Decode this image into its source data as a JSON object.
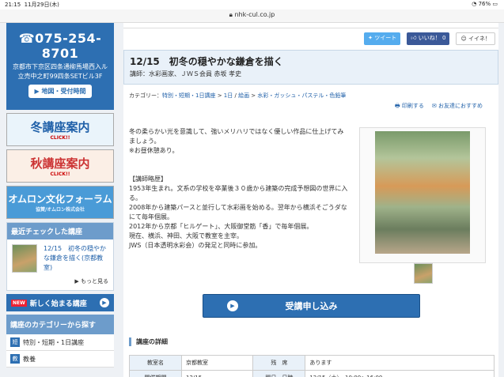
{
  "status": {
    "time": "21:15",
    "date": "11月29日(木)",
    "battery": "76%"
  },
  "browser": {
    "url": "nhk-cul.co.jp"
  },
  "sidebar": {
    "phone": "075-254-8701",
    "address1": "京都市下京区四条通柳馬場西入ル",
    "address2": "立売中之町99四条SETビル3F",
    "map_button": "地図・受付時間",
    "winter_banner": {
      "big": "冬講座案内",
      "small": "CLICK!!"
    },
    "autumn_banner": {
      "big": "秋講座案内",
      "small": "CLICK!!"
    },
    "omron_banner": {
      "big": "オムロン文化フォーラム",
      "small": "協賛/オムロン株式会社"
    },
    "recent_title": "最近チェックした講座",
    "recent_item": "12/15　初冬の穏やかな鎌倉を描く(京都教室)",
    "recent_more": "もっと見る",
    "new_tag": "NEW",
    "new_courses": "新しく始まる講座",
    "category_title": "講座のカテゴリーから探す",
    "categories": [
      {
        "icon": "短",
        "label": "特別・短期・1日講座"
      },
      {
        "icon": "教",
        "label": "教養"
      }
    ]
  },
  "share": {
    "tweet": "ツイート",
    "like": "いいね！ 0",
    "hatena": "イイネ！"
  },
  "course": {
    "title": "12/15　初冬の穏やかな鎌倉を描く",
    "lecturer": "講師：水彩画家、ＪＷＳ会員 赤坂 孝史",
    "category_prefix": "カテゴリー：",
    "crumbs": [
      "特別・短期・1日講座",
      "1日",
      "絵画",
      "水彩・ガッシュ・パステル・色鉛筆"
    ],
    "print": "印刷する",
    "mail": "お友達におすすめ",
    "description": [
      "冬の柔らかい光を意識して、強いメリハリではなく優しい作品に仕上げてみましょう。",
      "※お昼休憩あり。",
      "",
      "【講師略歴】",
      "1953年生まれ。文系の学校を卒業後３０歳から建築の完成予想図の世界に入る。",
      "2008年から建築パースと並行して水彩画を始める。翌年から横浜そごうダなにて毎年個展。",
      "2012年から京都「ヒルゲート」、大阪御堂筋「香」で毎年個展。",
      "現在、横浜、神田、大阪で教室を主宰。",
      "JWS（日本透明水彩会）の発足と同時に参加。"
    ],
    "apply_button": "受講申し込み",
    "detail_heading": "講座の詳細",
    "details": [
      {
        "k1": "教室名",
        "v1": "京都教室",
        "k2": "残　席",
        "v2": "あります"
      },
      {
        "k1": "開催期間",
        "v1": "12/15",
        "k2": "曜日・日時",
        "v2": "12/15（土）　10:00～16:00"
      }
    ]
  }
}
